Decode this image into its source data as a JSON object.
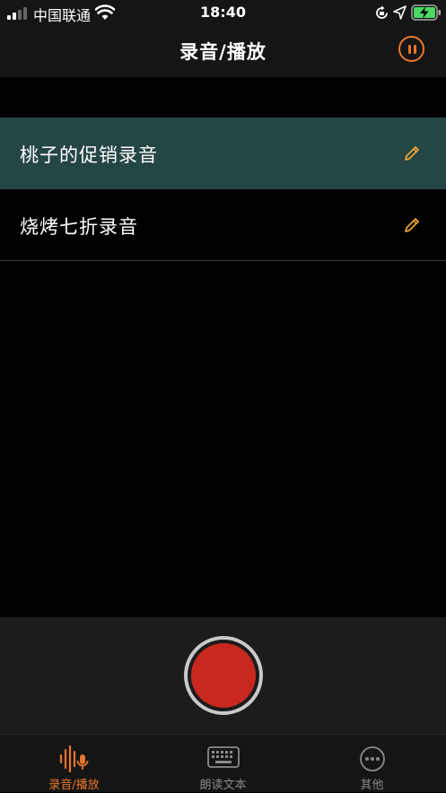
{
  "status_bar": {
    "carrier": "中国联通",
    "time": "18:40"
  },
  "nav": {
    "title": "录音/播放"
  },
  "recordings": [
    {
      "label": "桃子的促销录音",
      "selected": true
    },
    {
      "label": "烧烤七折录音",
      "selected": false
    }
  ],
  "tabs": [
    {
      "label": "录音/播放",
      "icon": "waveform-mic-icon",
      "active": true
    },
    {
      "label": "朗读文本",
      "icon": "keyboard-icon",
      "active": false
    },
    {
      "label": "其他",
      "icon": "more-icon",
      "active": false
    }
  ],
  "colors": {
    "accent": "#e9772a",
    "selected_row": "#244645",
    "record": "#c8281e"
  }
}
